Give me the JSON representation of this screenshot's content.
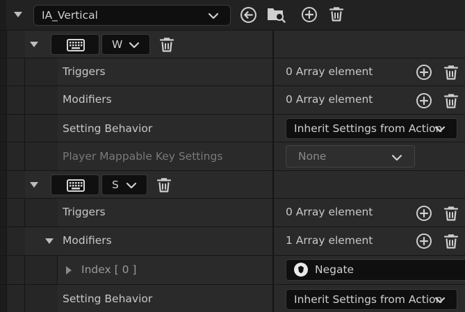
{
  "asset": {
    "name": "IA_Vertical",
    "icons": [
      "back-arrow-icon",
      "browse-folder-icon",
      "add-icon",
      "delete-icon"
    ]
  },
  "mappings": [
    {
      "key": "W",
      "rows": {
        "triggers": {
          "label": "Triggers",
          "value": "0 Array element"
        },
        "modifiers": {
          "label": "Modifiers",
          "value": "0 Array element"
        },
        "setting_behavior": {
          "label": "Setting Behavior",
          "value": "Inherit Settings from Action"
        },
        "player_mappable": {
          "label": "Player Mappable Key Settings",
          "value": "None"
        }
      }
    },
    {
      "key": "S",
      "rows": {
        "triggers": {
          "label": "Triggers",
          "value": "0 Array element"
        },
        "modifiers": {
          "label": "Modifiers",
          "value": "1 Array element"
        },
        "index0": {
          "label": "Index [ 0 ]",
          "value": "Negate"
        },
        "setting_behavior": {
          "label": "Setting Behavior",
          "value": "Inherit Settings from Action"
        }
      }
    }
  ],
  "colors": {
    "background": "#1a1a1a",
    "row": "#2a2a2a",
    "field": "#0f0f0f",
    "text": "#c8c8c8",
    "muted": "#7a7a7a"
  }
}
